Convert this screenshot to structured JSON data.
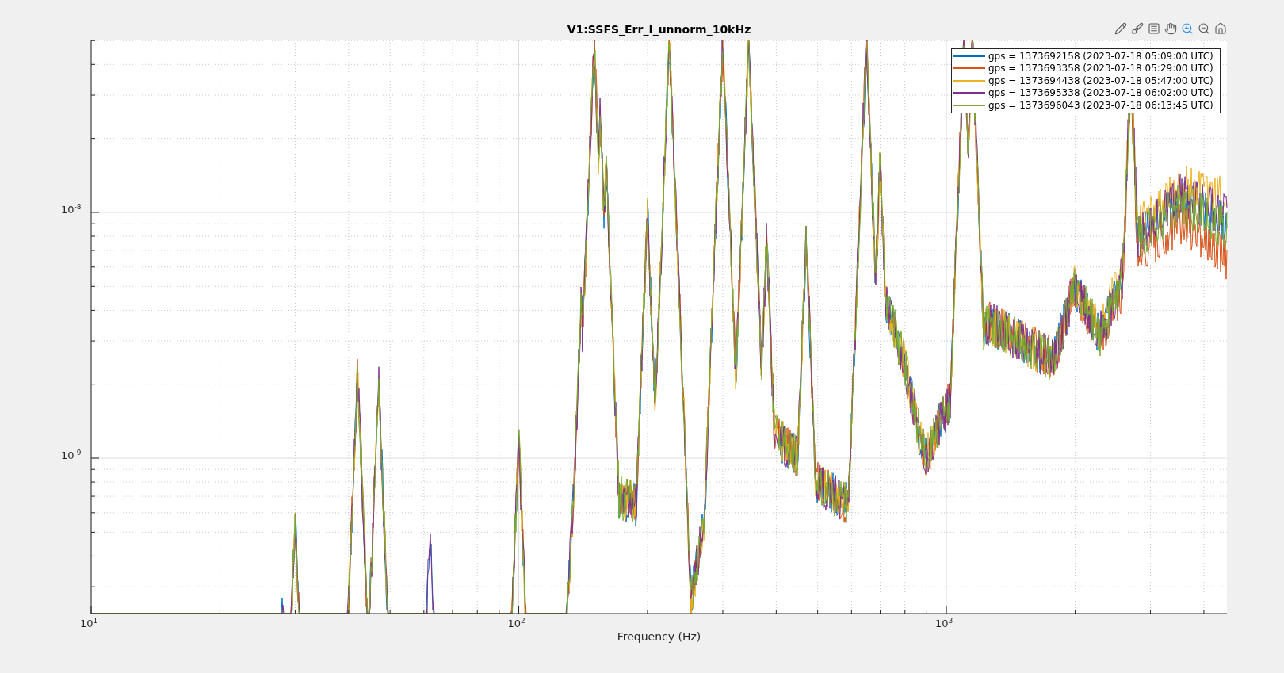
{
  "figure": {
    "toolbar": [
      {
        "kind": "data-tip"
      },
      {
        "kind": "brush"
      },
      {
        "kind": "legend"
      },
      {
        "kind": "pan"
      },
      {
        "kind": "zoom-in",
        "selected": true
      },
      {
        "kind": "zoom-out"
      },
      {
        "kind": "home"
      }
    ],
    "plot": {
      "title": "V1:SSFS_Err_I_unnorm_10kHz",
      "xlabel": "Frequency (Hz)",
      "x_ticks": [
        "10$^{1}$",
        "10$^{2}$",
        "10$^{3}$"
      ],
      "y_ticks": [
        "10$^{-8}$",
        "10$^{-9}$"
      ],
      "legend": [
        {
          "label": "gps = 1373692158 (2023-07-18 05:09:00 UTC)",
          "color": "#0072bd"
        },
        {
          "label": "gps = 1373693358 (2023-07-18 05:29:00 UTC)",
          "color": "#d95319"
        },
        {
          "label": "gps = 1373694438 (2023-07-18 05:47:00 UTC)",
          "color": "#edb120"
        },
        {
          "label": "gps = 1373695338 (2023-07-18 06:02:00 UTC)",
          "color": "#7e2f8e"
        },
        {
          "label": "gps = 1373696043 (2023-07-18 06:13:45 UTC)",
          "color": "#77ac30"
        }
      ]
    }
  }
}
